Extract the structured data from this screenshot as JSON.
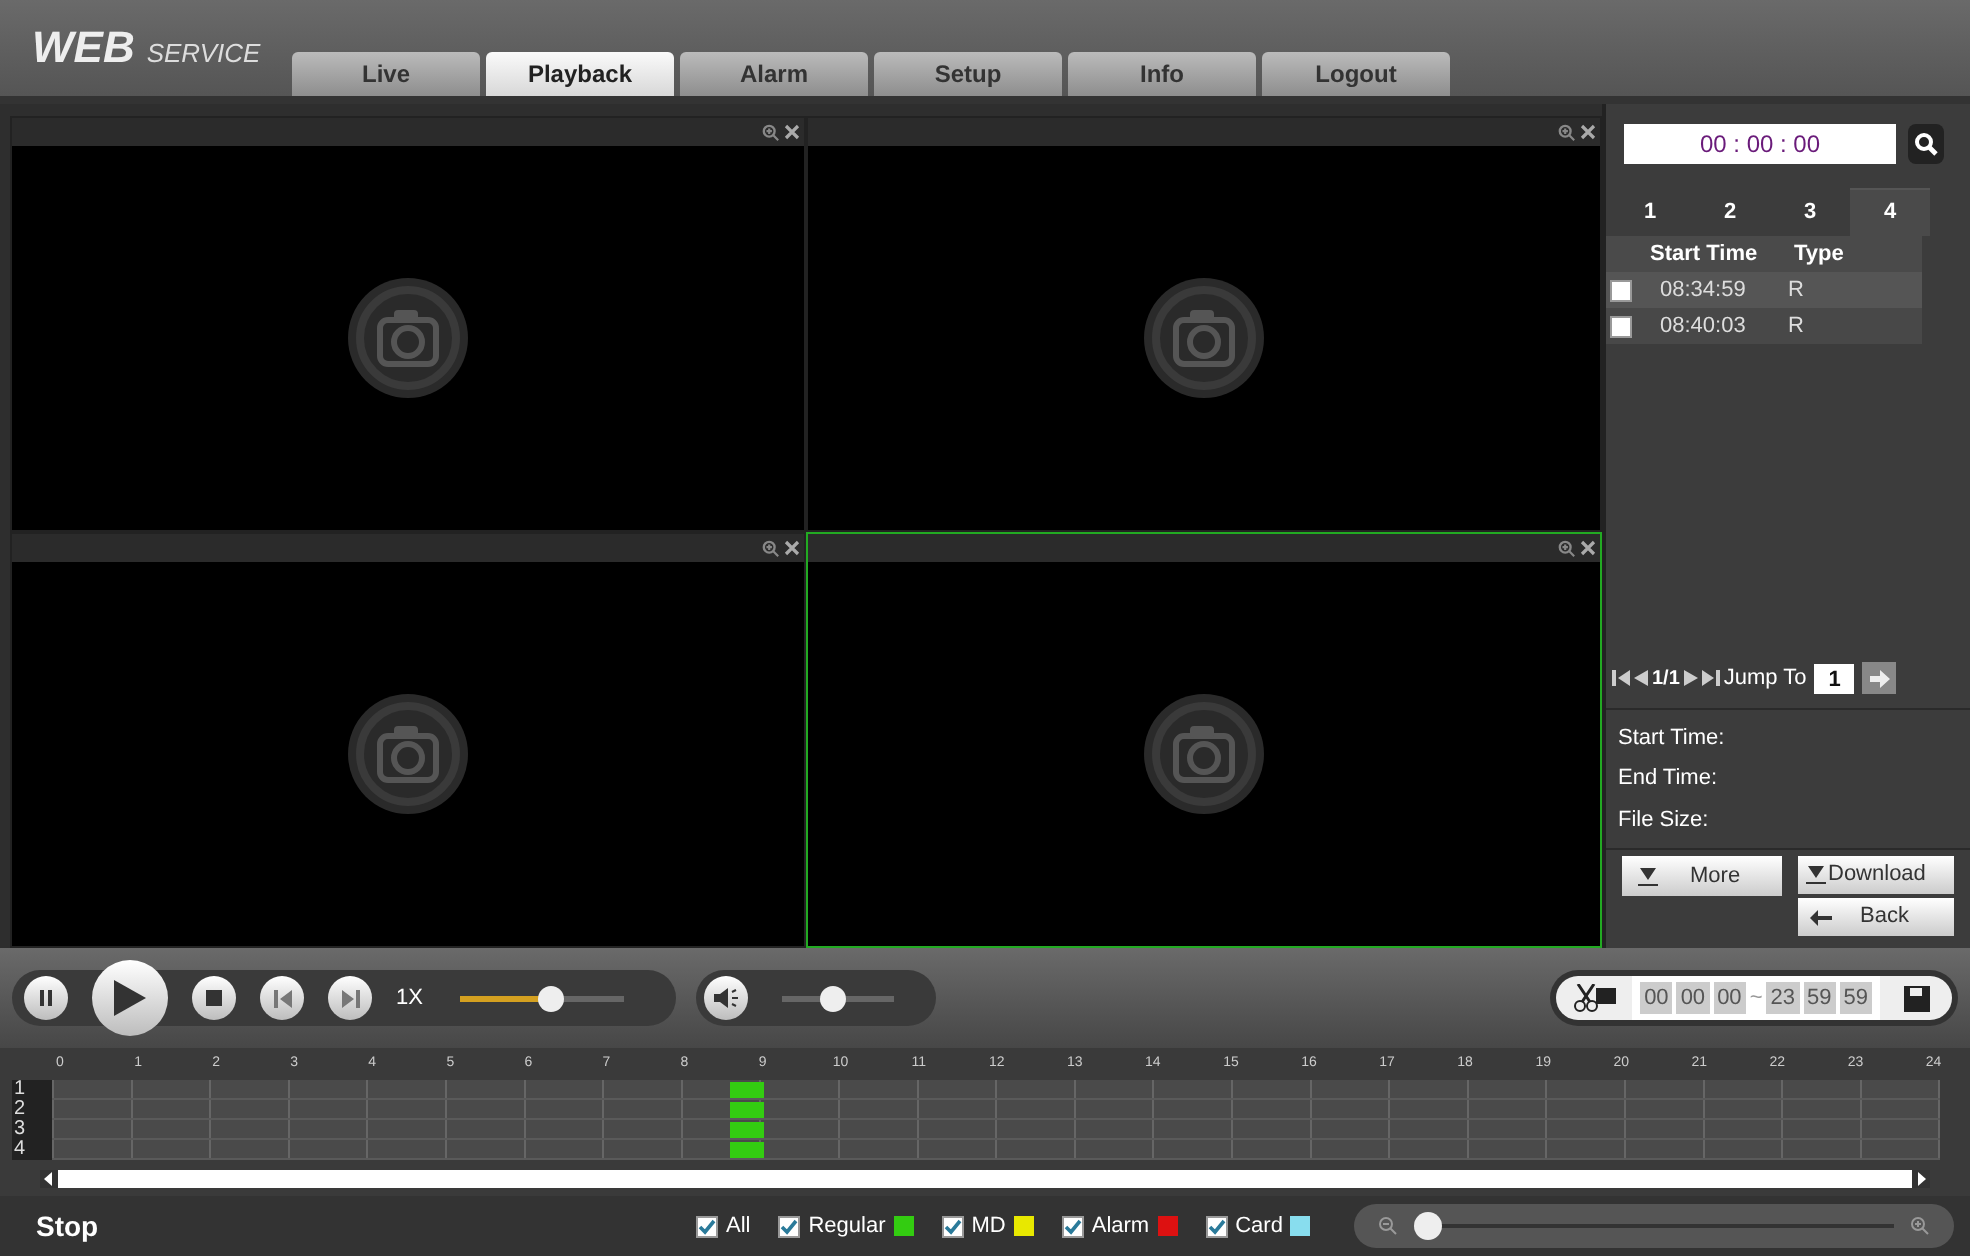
{
  "logo": {
    "main": "WEB",
    "sub": "SERVICE"
  },
  "tabs": [
    {
      "label": "Live",
      "selected": false
    },
    {
      "label": "Playback",
      "selected": true
    },
    {
      "label": "Alarm",
      "selected": false
    },
    {
      "label": "Setup",
      "selected": false
    },
    {
      "label": "Info",
      "selected": false
    },
    {
      "label": "Logout",
      "selected": false
    }
  ],
  "panes": [
    {
      "selected": false
    },
    {
      "selected": false
    },
    {
      "selected": false
    },
    {
      "selected": true
    }
  ],
  "side": {
    "time": "00 : 00 : 00",
    "channels": [
      {
        "label": "1",
        "selected": false
      },
      {
        "label": "2",
        "selected": false
      },
      {
        "label": "3",
        "selected": false
      },
      {
        "label": "4",
        "selected": true
      }
    ],
    "columns": [
      "Start Time",
      "Type"
    ],
    "files": [
      {
        "time": "08:34:59",
        "type": "R",
        "checked": false
      },
      {
        "time": "08:40:03",
        "type": "R",
        "checked": false
      }
    ],
    "page": "1/1",
    "jump_label": "Jump To",
    "jump_value": "1",
    "info": [
      "Start Time:",
      "End Time:",
      "File Size:"
    ],
    "buttons": {
      "more": "More",
      "download": "Download",
      "back": "Back"
    }
  },
  "controls": {
    "speed": "1X",
    "speed_level": {
      "level": 0.55
    },
    "volume": {
      "level": 0.45
    },
    "clip": {
      "start": [
        "00",
        "00",
        "00"
      ],
      "sep": "~",
      "end": [
        "23",
        "59",
        "59"
      ]
    }
  },
  "timeline": {
    "hours": [
      "0",
      "1",
      "2",
      "3",
      "4",
      "5",
      "6",
      "7",
      "8",
      "9",
      "10",
      "11",
      "12",
      "13",
      "14",
      "15",
      "16",
      "17",
      "18",
      "19",
      "20",
      "21",
      "22",
      "23",
      "24"
    ],
    "rows": [
      {
        "label": "1",
        "recording": true,
        "color": "#33cc11"
      },
      {
        "label": "2",
        "recording": true,
        "color": "#33cc11"
      },
      {
        "label": "3",
        "recording": true,
        "color": "#33cc11"
      },
      {
        "label": "4",
        "recording": true,
        "color": "#33cc11"
      }
    ]
  },
  "status": "Stop",
  "filters": [
    {
      "label": "All",
      "checked": true
    },
    {
      "label": "Regular",
      "checked": true,
      "color": "#33cc11"
    },
    {
      "label": "MD",
      "checked": true,
      "color": "#e8e800"
    },
    {
      "label": "Alarm",
      "checked": true,
      "color": "#dd1111"
    },
    {
      "label": "Card",
      "checked": true,
      "color": "#88ddee"
    }
  ],
  "zoom": {
    "level": 0
  }
}
